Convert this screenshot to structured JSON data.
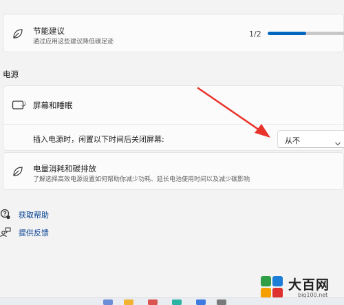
{
  "energy_recommendations": {
    "title": "节能建议",
    "subtitle": "通过应用这些建议降低碳足迹",
    "progress_text": "1/2",
    "progress_fraction": 0.5
  },
  "power_section": {
    "label": "电源",
    "screen_sleep": {
      "title": "屏幕和睡眠",
      "row_label": "插入电源时，闲置以下时间后关闭屏幕:",
      "select_value": "从不"
    },
    "power_consumption": {
      "title": "电量消耗和碳排放",
      "subtitle": "了解选择高效电源设置如何帮助你减少功耗、延长电池使用时间以及减少碳影响"
    }
  },
  "links": {
    "get_help": "获取帮助",
    "feedback": "提供反馈"
  },
  "watermark": {
    "title": "大百网",
    "url": "big100.net"
  },
  "colors": {
    "accent": "#0067c0",
    "link": "#003e92",
    "arrow": "#e8332a",
    "background": "#f3f3f3",
    "card": "#fbfbfb"
  }
}
